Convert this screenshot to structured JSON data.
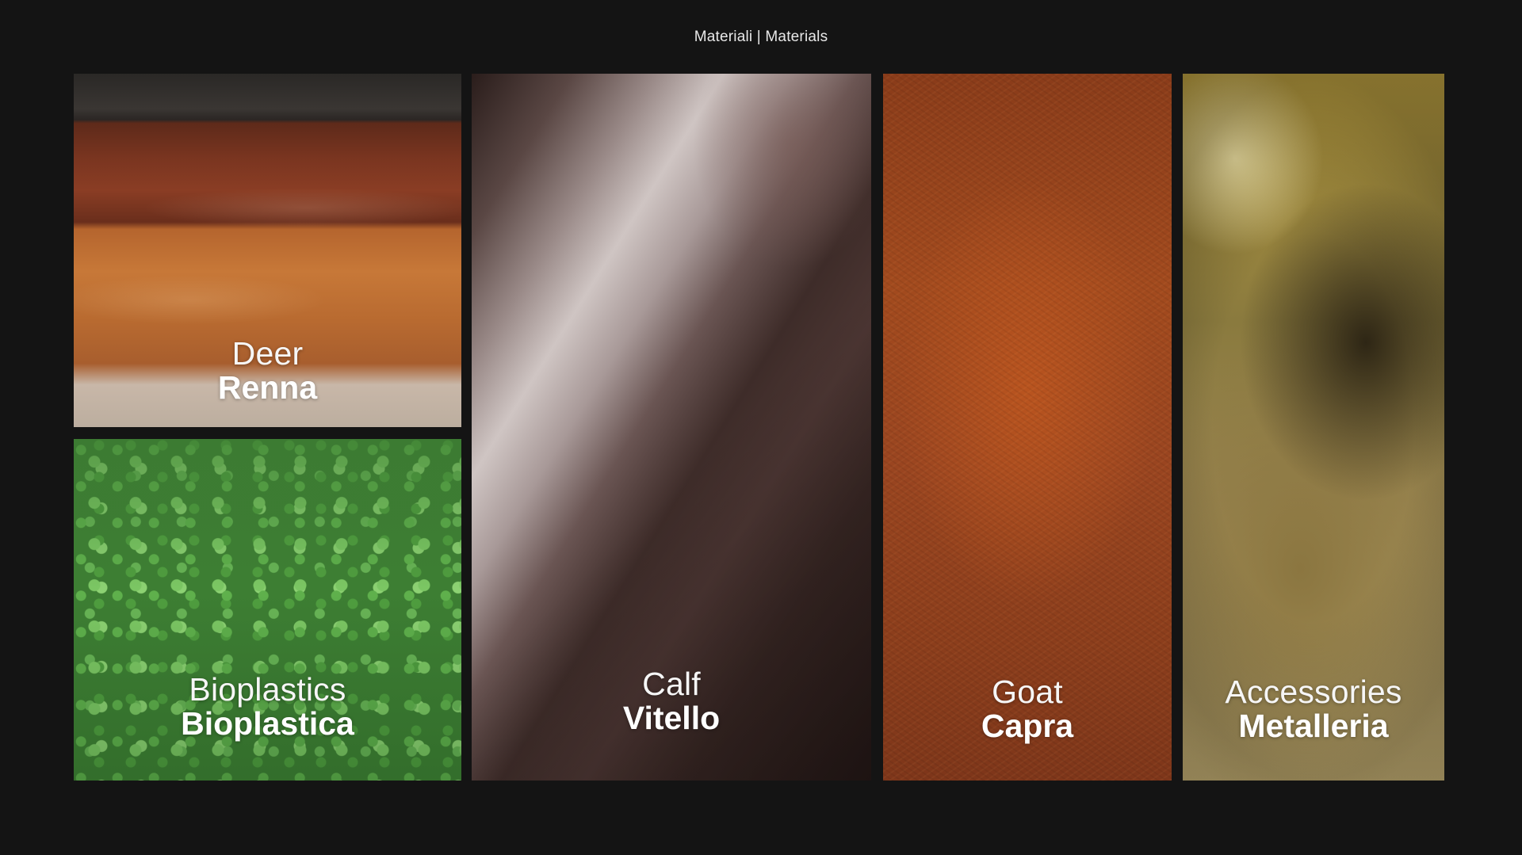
{
  "header": {
    "title": "Materiali | Materials"
  },
  "materials": [
    {
      "english": "Deer",
      "italian": "Renna"
    },
    {
      "english": "Bioplastics",
      "italian": "Bioplastica"
    },
    {
      "english": "Calf",
      "italian": "Vitello"
    },
    {
      "english": "Goat",
      "italian": "Capra"
    },
    {
      "english": "Accessories",
      "italian": "Metalleria"
    }
  ]
}
